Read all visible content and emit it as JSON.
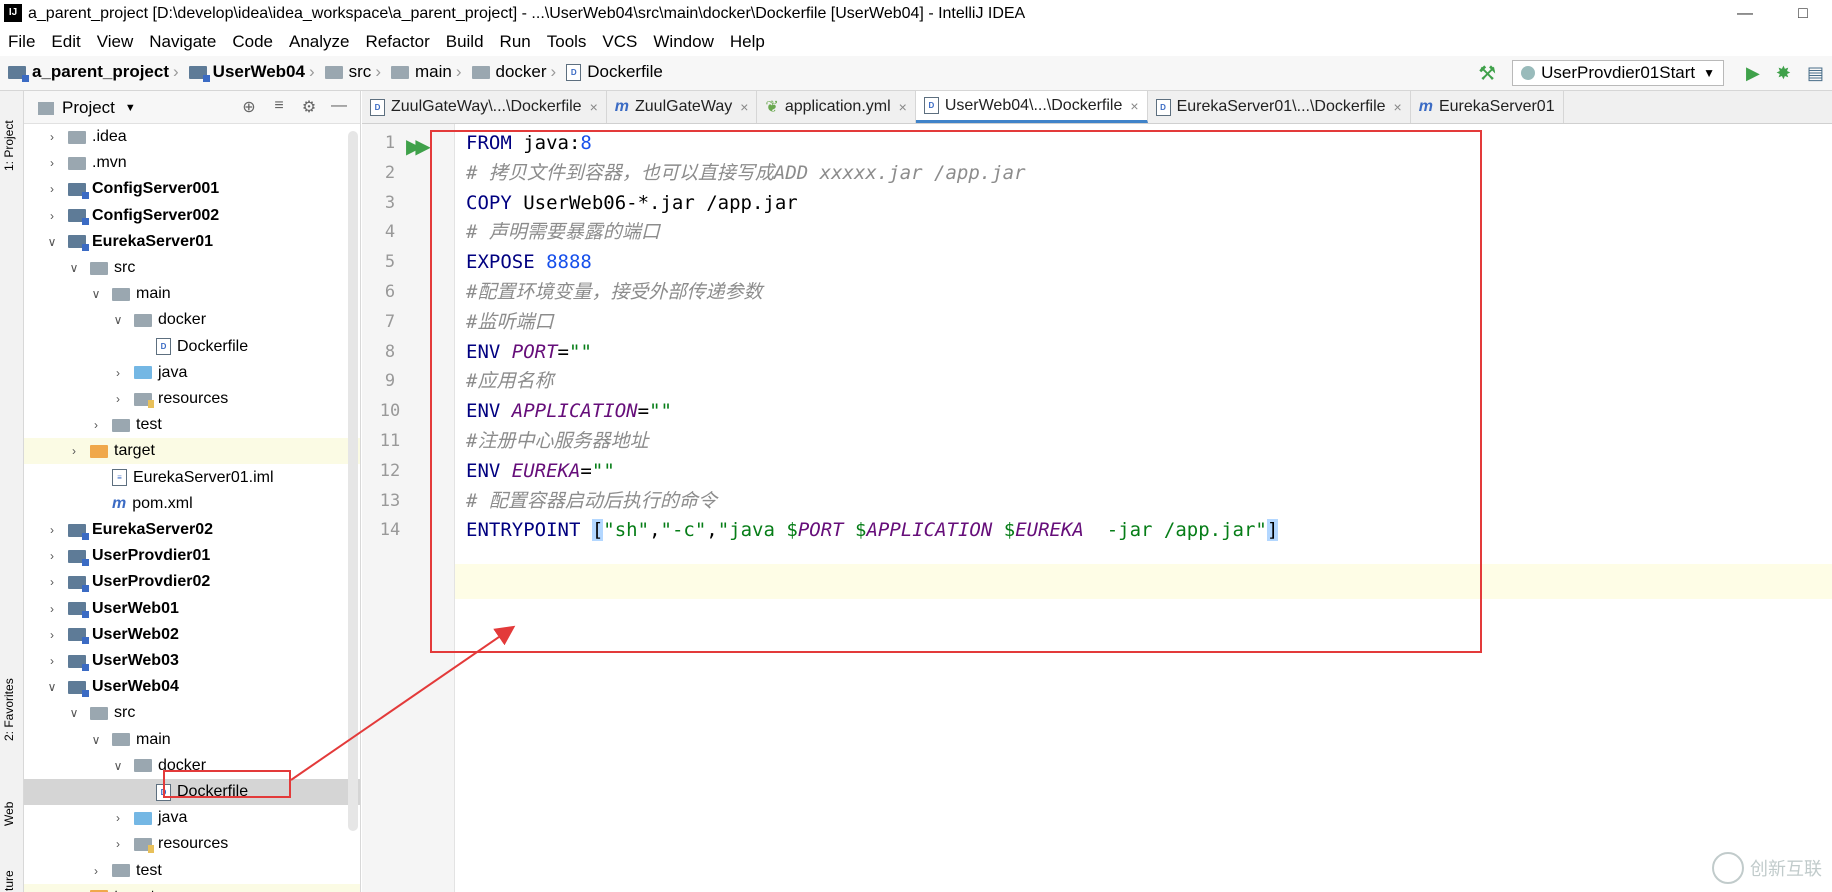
{
  "window": {
    "title": "a_parent_project [D:\\develop\\idea\\idea_workspace\\a_parent_project] - ...\\UserWeb04\\src\\main\\docker\\Dockerfile [UserWeb04] - IntelliJ IDEA",
    "app_icon": "IJ"
  },
  "menu": [
    "File",
    "Edit",
    "View",
    "Navigate",
    "Code",
    "Analyze",
    "Refactor",
    "Build",
    "Run",
    "Tools",
    "VCS",
    "Window",
    "Help"
  ],
  "breadcrumbs": [
    "a_parent_project",
    "UserWeb04",
    "src",
    "main",
    "docker",
    "Dockerfile"
  ],
  "run_config": "UserProvdier01Start",
  "left_strip": {
    "project": "1: Project",
    "favorites": "2: Favorites",
    "web": "Web",
    "structure": "ture"
  },
  "project_panel": {
    "title": "Project"
  },
  "tree": [
    {
      "label": ".idea",
      "indent": 1,
      "arrow": "right",
      "icon": "folder"
    },
    {
      "label": ".mvn",
      "indent": 1,
      "arrow": "right",
      "icon": "folder"
    },
    {
      "label": "ConfigServer001",
      "indent": 1,
      "arrow": "right",
      "icon": "module",
      "bold": true
    },
    {
      "label": "ConfigServer002",
      "indent": 1,
      "arrow": "right",
      "icon": "module",
      "bold": true
    },
    {
      "label": "EurekaServer01",
      "indent": 1,
      "arrow": "down",
      "icon": "module",
      "bold": true
    },
    {
      "label": "src",
      "indent": 2,
      "arrow": "down",
      "icon": "folder"
    },
    {
      "label": "main",
      "indent": 3,
      "arrow": "down",
      "icon": "folder"
    },
    {
      "label": "docker",
      "indent": 4,
      "arrow": "down",
      "icon": "folder"
    },
    {
      "label": "Dockerfile",
      "indent": 5,
      "arrow": "none",
      "icon": "file"
    },
    {
      "label": "java",
      "indent": 4,
      "arrow": "right",
      "icon": "blue"
    },
    {
      "label": "resources",
      "indent": 4,
      "arrow": "right",
      "icon": "res"
    },
    {
      "label": "test",
      "indent": 3,
      "arrow": "right",
      "icon": "folder"
    },
    {
      "label": "target",
      "indent": 2,
      "arrow": "right",
      "icon": "orange",
      "hl": "yellow"
    },
    {
      "label": "EurekaServer01.iml",
      "indent": 3,
      "arrow": "none",
      "icon": "iml"
    },
    {
      "label": "pom.xml",
      "indent": 3,
      "arrow": "none",
      "icon": "pom"
    },
    {
      "label": "EurekaServer02",
      "indent": 1,
      "arrow": "right",
      "icon": "module",
      "bold": true
    },
    {
      "label": "UserProvdier01",
      "indent": 1,
      "arrow": "right",
      "icon": "module",
      "bold": true
    },
    {
      "label": "UserProvdier02",
      "indent": 1,
      "arrow": "right",
      "icon": "module",
      "bold": true
    },
    {
      "label": "UserWeb01",
      "indent": 1,
      "arrow": "right",
      "icon": "module",
      "bold": true
    },
    {
      "label": "UserWeb02",
      "indent": 1,
      "arrow": "right",
      "icon": "module",
      "bold": true
    },
    {
      "label": "UserWeb03",
      "indent": 1,
      "arrow": "right",
      "icon": "module",
      "bold": true
    },
    {
      "label": "UserWeb04",
      "indent": 1,
      "arrow": "down",
      "icon": "module",
      "bold": true
    },
    {
      "label": "src",
      "indent": 2,
      "arrow": "down",
      "icon": "folder"
    },
    {
      "label": "main",
      "indent": 3,
      "arrow": "down",
      "icon": "folder"
    },
    {
      "label": "docker",
      "indent": 4,
      "arrow": "down",
      "icon": "folder"
    },
    {
      "label": "Dockerfile",
      "indent": 5,
      "arrow": "none",
      "icon": "file",
      "hl": "sel"
    },
    {
      "label": "java",
      "indent": 4,
      "arrow": "right",
      "icon": "blue"
    },
    {
      "label": "resources",
      "indent": 4,
      "arrow": "right",
      "icon": "res"
    },
    {
      "label": "test",
      "indent": 3,
      "arrow": "right",
      "icon": "folder"
    },
    {
      "label": "target",
      "indent": 2,
      "arrow": "right",
      "icon": "orange",
      "hl": "yellow"
    }
  ],
  "tabs": [
    {
      "label": "ZuulGateWay\\...\\Dockerfile",
      "icon": "file",
      "active": false
    },
    {
      "label": "ZuulGateWay",
      "icon": "m",
      "active": false
    },
    {
      "label": "application.yml",
      "icon": "leaf",
      "active": false
    },
    {
      "label": "UserWeb04\\...\\Dockerfile",
      "icon": "file",
      "active": true
    },
    {
      "label": "EurekaServer01\\...\\Dockerfile",
      "icon": "file",
      "active": false
    },
    {
      "label": "EurekaServer01",
      "icon": "m",
      "active": false,
      "no_close": true
    }
  ],
  "code": [
    [
      [
        "kw",
        "FROM"
      ],
      [
        "plain",
        " java:"
      ],
      [
        "num",
        "8"
      ]
    ],
    [
      [
        "cm",
        "# 拷贝文件到容器，也可以直接写成ADD xxxxx.jar /app.jar"
      ]
    ],
    [
      [
        "kw",
        "COPY"
      ],
      [
        "plain",
        " UserWeb06-*.jar /app.jar"
      ]
    ],
    [
      [
        "cm",
        "# 声明需要暴露的端口"
      ]
    ],
    [
      [
        "kw",
        "EXPOSE"
      ],
      [
        "plain",
        " "
      ],
      [
        "num",
        "8888"
      ]
    ],
    [
      [
        "cm",
        "#配置环境变量，接受外部传递参数"
      ]
    ],
    [
      [
        "cm",
        "#监听端口"
      ]
    ],
    [
      [
        "kw",
        "ENV"
      ],
      [
        "plain",
        " "
      ],
      [
        "var",
        "PORT"
      ],
      [
        "plain",
        "="
      ],
      [
        "str",
        "\"\""
      ]
    ],
    [
      [
        "cm",
        "#应用名称"
      ]
    ],
    [
      [
        "kw",
        "ENV"
      ],
      [
        "plain",
        " "
      ],
      [
        "var",
        "APPLICATION"
      ],
      [
        "plain",
        "="
      ],
      [
        "str",
        "\"\""
      ]
    ],
    [
      [
        "cm",
        "#注册中心服务器地址"
      ]
    ],
    [
      [
        "kw",
        "ENV"
      ],
      [
        "plain",
        " "
      ],
      [
        "var",
        "EUREKA"
      ],
      [
        "plain",
        "="
      ],
      [
        "str",
        "\"\""
      ]
    ],
    [
      [
        "cm",
        "# 配置容器启动后执行的命令"
      ]
    ],
    [
      [
        "kw",
        "ENTRYPOINT"
      ],
      [
        "plain",
        " "
      ],
      [
        "brk",
        "["
      ],
      [
        "str",
        "\"sh\""
      ],
      [
        "plain",
        ","
      ],
      [
        "str",
        "\"-c\""
      ],
      [
        "plain",
        ","
      ],
      [
        "str",
        "\"java $"
      ],
      [
        "var",
        "PORT"
      ],
      [
        "str",
        " $"
      ],
      [
        "var",
        "APPLICATION"
      ],
      [
        "str",
        " $"
      ],
      [
        "var",
        "EUREKA"
      ],
      [
        "str",
        "  -jar /app.jar\""
      ],
      [
        "brk",
        "]"
      ]
    ]
  ],
  "watermark": "创新互联",
  "colors": {
    "annotation_red": "#e33a3a",
    "keyword": "#000080",
    "comment": "#8c8c8c",
    "string": "#067d17",
    "variable": "#660e7a",
    "number": "#1750eb"
  }
}
